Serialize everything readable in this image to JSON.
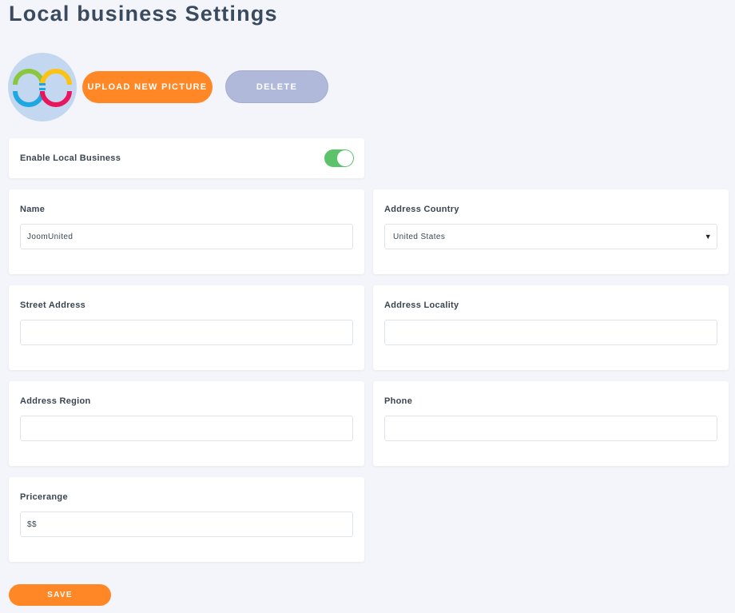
{
  "page": {
    "title": "Local business Settings"
  },
  "picture": {
    "upload_label": "UPLOAD NEW PICTURE",
    "delete_label": "DELETE"
  },
  "enable": {
    "label": "Enable Local Business",
    "enabled": true,
    "color": "#5cc36b"
  },
  "fields": {
    "name": {
      "label": "Name",
      "value": "JoomUnited"
    },
    "country": {
      "label": "Address Country",
      "value": "United States"
    },
    "street": {
      "label": "Street Address",
      "value": ""
    },
    "locality": {
      "label": "Address Locality",
      "value": ""
    },
    "region": {
      "label": "Address Region",
      "value": ""
    },
    "phone": {
      "label": "Phone",
      "value": ""
    },
    "pricerange": {
      "label": "Pricerange",
      "value": "$$"
    }
  },
  "icons": {
    "caret": "▼",
    "logo": "joomunited-logo-icon"
  },
  "save": {
    "label": "SAVE"
  },
  "colors": {
    "accent": "#ff8726",
    "delete": "#b1b9db",
    "toggle": "#5cc36b",
    "title": "#3b4b5f"
  }
}
